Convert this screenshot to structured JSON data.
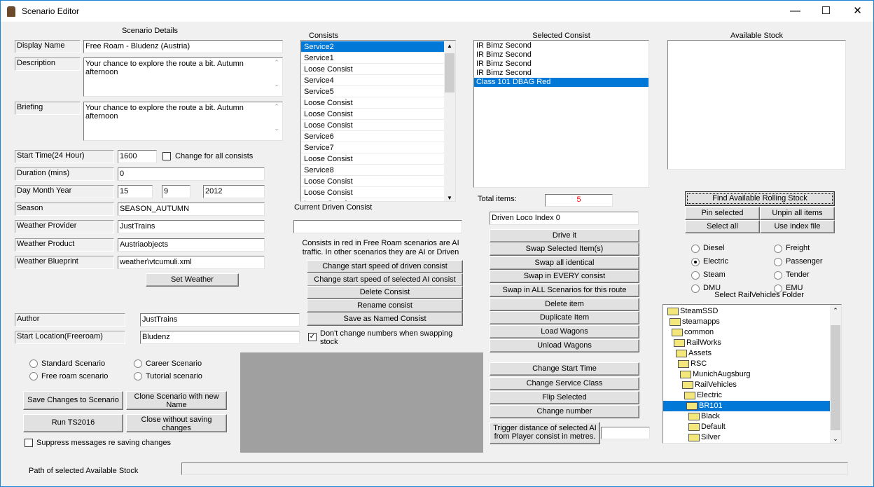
{
  "window": {
    "title": "Scenario Editor",
    "minimize": "—",
    "maximize": "☐",
    "close": "✕"
  },
  "details": {
    "heading": "Scenario Details",
    "display_name_label": "Display Name",
    "display_name": "Free Roam - Bludenz (Austria)",
    "description_label": "Description",
    "description": "Your chance to explore the route a bit. Autumn afternoon",
    "briefing_label": "Briefing",
    "briefing": "Your chance to explore the route a bit. Autumn afternoon",
    "start_time_label": "Start Time(24 Hour)",
    "start_time": "1600",
    "change_all_label": "Change for all consists",
    "duration_label": "Duration (mins)",
    "duration": "0",
    "date_label": "Day Month Year",
    "day": "15",
    "month": "9",
    "year": "2012",
    "season_label": "Season",
    "season": "SEASON_AUTUMN",
    "weather_provider_label": "Weather Provider",
    "weather_provider": "JustTrains",
    "weather_product_label": "Weather Product",
    "weather_product": "Austriaobjects",
    "weather_blueprint_label": "Weather Blueprint",
    "weather_blueprint": "weather\\vtcumuli.xml",
    "set_weather": "Set Weather",
    "author_label": "Author",
    "author": "JustTrains",
    "start_location_label": "Start Location(Freeroam)",
    "start_location": "Bludenz"
  },
  "scenario_type": {
    "standard": "Standard Scenario",
    "career": "Career Scenario",
    "free_roam": "Free roam scenario",
    "tutorial": "Tutorial scenario"
  },
  "actions": {
    "save": "Save Changes to Scenario",
    "clone": "Clone Scenario with new Name",
    "run": "Run TS2016",
    "close": "Close without saving changes",
    "suppress": "Suppress messages re saving changes"
  },
  "path_label": "Path of selected Available Stock",
  "consists": {
    "label": "Consists",
    "items": [
      "Service2",
      "Service1",
      "Loose Consist",
      "Service4",
      "Service5",
      "Loose Consist",
      "Loose Consist",
      "Loose Consist",
      "Service6",
      "Service7",
      "Loose Consist",
      "Service8",
      "Loose Consist",
      "Loose Consist",
      "Loose Consist"
    ],
    "current_driven_label": "Current Driven Consist",
    "current_driven": "",
    "note": "Consists in red in Free Roam scenarios are AI traffic. In other scenarios they are AI or Driven",
    "buttons": [
      "Change start speed of driven consist",
      "Change start speed of selected AI consist",
      "Delete Consist",
      "Rename consist",
      "Save as Named Consist"
    ],
    "dont_change_numbers": "Don't change numbers when swapping stock"
  },
  "selected": {
    "label": "Selected Consist",
    "items": [
      "IR Bimz Second",
      "IR Bimz Second",
      "IR Bimz Second",
      "IR Bimz Second",
      "Class 101 DBAG Red"
    ],
    "total_label": "Total items:",
    "total": "5",
    "driven_index": "Driven Loco Index 0",
    "buttons": [
      "Drive it",
      "Swap Selected Item(s)",
      "Swap all identical",
      "Swap in EVERY consist",
      "Swap in ALL Scenarios for this route",
      "Delete item",
      "Duplicate Item",
      "Load Wagons",
      "Unload Wagons"
    ],
    "buttons2": [
      "Change Start Time",
      "Change Service Class",
      "Flip Selected",
      "Change number"
    ],
    "trigger": "Trigger distance of selected AI from Player consist in metres.",
    "trigger_value": ""
  },
  "stock": {
    "label": "Available Stock",
    "find": "Find Available Rolling Stock",
    "pin": "Pin selected",
    "unpin": "Unpin all items",
    "select_all": "Select all",
    "use_index": "Use index file",
    "types": [
      "Diesel",
      "Electric",
      "Steam",
      "DMU",
      "Freight",
      "Passenger",
      "Tender",
      "EMU"
    ],
    "folder_label": "Select RailVehicles Folder",
    "tree": [
      "SteamSSD",
      "steamapps",
      "common",
      "RailWorks",
      "Assets",
      "RSC",
      "MunichAugsburg",
      "RailVehicles",
      "Electric",
      "BR101",
      "Black",
      "Default",
      "Silver"
    ]
  },
  "colors": {
    "selection": "#0078d7",
    "total": "#ff0000",
    "preview": "#a0a0a0"
  }
}
